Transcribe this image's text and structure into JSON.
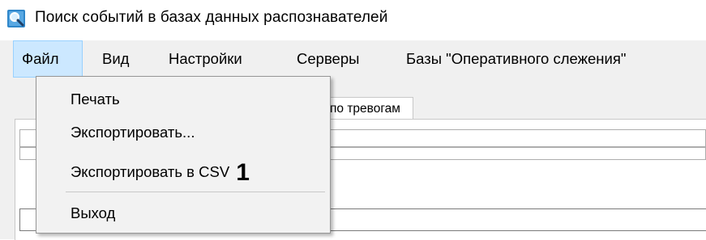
{
  "window": {
    "title": "Поиск событий в базах данных распознавателей",
    "icon": "search-magnifier-icon"
  },
  "menubar": {
    "items": [
      {
        "label": "Файл",
        "active": true
      },
      {
        "label": "Вид"
      },
      {
        "label": "Настройки"
      },
      {
        "label": "Серверы"
      },
      {
        "label": "Базы \"Оперативного слежения\""
      }
    ]
  },
  "file_menu": {
    "items": [
      {
        "label": "Печать"
      },
      {
        "label": "Экспортировать..."
      },
      {
        "label": "Экспортировать в CSV",
        "callout": "1"
      },
      {
        "label": "Выход"
      }
    ]
  },
  "tab": {
    "label": "по тревогам"
  },
  "colors": {
    "menu_active_bg": "#cce8ff",
    "menu_active_border": "#99d1ff",
    "menubar_bg": "#f0f0f0",
    "dropdown_bg": "#f2f2f2"
  }
}
